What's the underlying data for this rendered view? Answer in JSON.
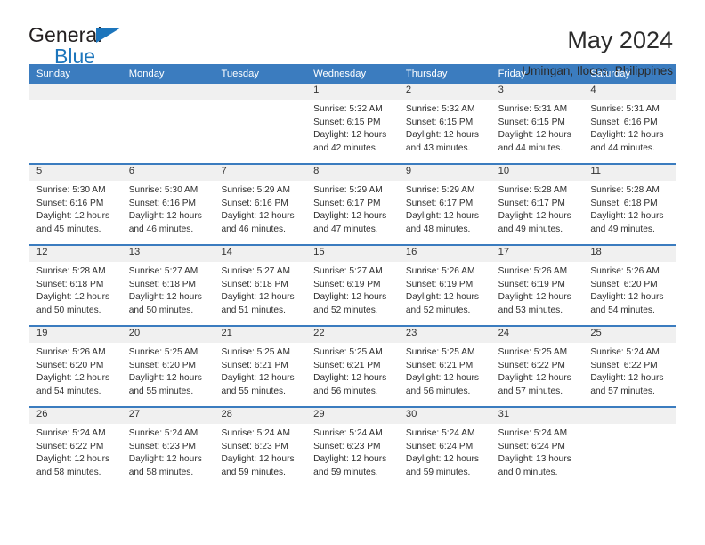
{
  "brand": {
    "name_part1": "General",
    "name_part2": "Blue",
    "triangle_icon": "triangle-icon",
    "accent_color": "#1c75bc"
  },
  "header": {
    "title": "May 2024",
    "subtitle": "Umingan, Ilocos, Philippines"
  },
  "calendar": {
    "header_bg": "#3b7cbf",
    "day_band_bg": "#f0f0f0",
    "weekdays": [
      "Sunday",
      "Monday",
      "Tuesday",
      "Wednesday",
      "Thursday",
      "Friday",
      "Saturday"
    ],
    "weeks": [
      [
        {
          "day": "",
          "lines": []
        },
        {
          "day": "",
          "lines": []
        },
        {
          "day": "",
          "lines": []
        },
        {
          "day": "1",
          "lines": [
            "Sunrise: 5:32 AM",
            "Sunset: 6:15 PM",
            "Daylight: 12 hours",
            "and 42 minutes."
          ]
        },
        {
          "day": "2",
          "lines": [
            "Sunrise: 5:32 AM",
            "Sunset: 6:15 PM",
            "Daylight: 12 hours",
            "and 43 minutes."
          ]
        },
        {
          "day": "3",
          "lines": [
            "Sunrise: 5:31 AM",
            "Sunset: 6:15 PM",
            "Daylight: 12 hours",
            "and 44 minutes."
          ]
        },
        {
          "day": "4",
          "lines": [
            "Sunrise: 5:31 AM",
            "Sunset: 6:16 PM",
            "Daylight: 12 hours",
            "and 44 minutes."
          ]
        }
      ],
      [
        {
          "day": "5",
          "lines": [
            "Sunrise: 5:30 AM",
            "Sunset: 6:16 PM",
            "Daylight: 12 hours",
            "and 45 minutes."
          ]
        },
        {
          "day": "6",
          "lines": [
            "Sunrise: 5:30 AM",
            "Sunset: 6:16 PM",
            "Daylight: 12 hours",
            "and 46 minutes."
          ]
        },
        {
          "day": "7",
          "lines": [
            "Sunrise: 5:29 AM",
            "Sunset: 6:16 PM",
            "Daylight: 12 hours",
            "and 46 minutes."
          ]
        },
        {
          "day": "8",
          "lines": [
            "Sunrise: 5:29 AM",
            "Sunset: 6:17 PM",
            "Daylight: 12 hours",
            "and 47 minutes."
          ]
        },
        {
          "day": "9",
          "lines": [
            "Sunrise: 5:29 AM",
            "Sunset: 6:17 PM",
            "Daylight: 12 hours",
            "and 48 minutes."
          ]
        },
        {
          "day": "10",
          "lines": [
            "Sunrise: 5:28 AM",
            "Sunset: 6:17 PM",
            "Daylight: 12 hours",
            "and 49 minutes."
          ]
        },
        {
          "day": "11",
          "lines": [
            "Sunrise: 5:28 AM",
            "Sunset: 6:18 PM",
            "Daylight: 12 hours",
            "and 49 minutes."
          ]
        }
      ],
      [
        {
          "day": "12",
          "lines": [
            "Sunrise: 5:28 AM",
            "Sunset: 6:18 PM",
            "Daylight: 12 hours",
            "and 50 minutes."
          ]
        },
        {
          "day": "13",
          "lines": [
            "Sunrise: 5:27 AM",
            "Sunset: 6:18 PM",
            "Daylight: 12 hours",
            "and 50 minutes."
          ]
        },
        {
          "day": "14",
          "lines": [
            "Sunrise: 5:27 AM",
            "Sunset: 6:18 PM",
            "Daylight: 12 hours",
            "and 51 minutes."
          ]
        },
        {
          "day": "15",
          "lines": [
            "Sunrise: 5:27 AM",
            "Sunset: 6:19 PM",
            "Daylight: 12 hours",
            "and 52 minutes."
          ]
        },
        {
          "day": "16",
          "lines": [
            "Sunrise: 5:26 AM",
            "Sunset: 6:19 PM",
            "Daylight: 12 hours",
            "and 52 minutes."
          ]
        },
        {
          "day": "17",
          "lines": [
            "Sunrise: 5:26 AM",
            "Sunset: 6:19 PM",
            "Daylight: 12 hours",
            "and 53 minutes."
          ]
        },
        {
          "day": "18",
          "lines": [
            "Sunrise: 5:26 AM",
            "Sunset: 6:20 PM",
            "Daylight: 12 hours",
            "and 54 minutes."
          ]
        }
      ],
      [
        {
          "day": "19",
          "lines": [
            "Sunrise: 5:26 AM",
            "Sunset: 6:20 PM",
            "Daylight: 12 hours",
            "and 54 minutes."
          ]
        },
        {
          "day": "20",
          "lines": [
            "Sunrise: 5:25 AM",
            "Sunset: 6:20 PM",
            "Daylight: 12 hours",
            "and 55 minutes."
          ]
        },
        {
          "day": "21",
          "lines": [
            "Sunrise: 5:25 AM",
            "Sunset: 6:21 PM",
            "Daylight: 12 hours",
            "and 55 minutes."
          ]
        },
        {
          "day": "22",
          "lines": [
            "Sunrise: 5:25 AM",
            "Sunset: 6:21 PM",
            "Daylight: 12 hours",
            "and 56 minutes."
          ]
        },
        {
          "day": "23",
          "lines": [
            "Sunrise: 5:25 AM",
            "Sunset: 6:21 PM",
            "Daylight: 12 hours",
            "and 56 minutes."
          ]
        },
        {
          "day": "24",
          "lines": [
            "Sunrise: 5:25 AM",
            "Sunset: 6:22 PM",
            "Daylight: 12 hours",
            "and 57 minutes."
          ]
        },
        {
          "day": "25",
          "lines": [
            "Sunrise: 5:24 AM",
            "Sunset: 6:22 PM",
            "Daylight: 12 hours",
            "and 57 minutes."
          ]
        }
      ],
      [
        {
          "day": "26",
          "lines": [
            "Sunrise: 5:24 AM",
            "Sunset: 6:22 PM",
            "Daylight: 12 hours",
            "and 58 minutes."
          ]
        },
        {
          "day": "27",
          "lines": [
            "Sunrise: 5:24 AM",
            "Sunset: 6:23 PM",
            "Daylight: 12 hours",
            "and 58 minutes."
          ]
        },
        {
          "day": "28",
          "lines": [
            "Sunrise: 5:24 AM",
            "Sunset: 6:23 PM",
            "Daylight: 12 hours",
            "and 59 minutes."
          ]
        },
        {
          "day": "29",
          "lines": [
            "Sunrise: 5:24 AM",
            "Sunset: 6:23 PM",
            "Daylight: 12 hours",
            "and 59 minutes."
          ]
        },
        {
          "day": "30",
          "lines": [
            "Sunrise: 5:24 AM",
            "Sunset: 6:24 PM",
            "Daylight: 12 hours",
            "and 59 minutes."
          ]
        },
        {
          "day": "31",
          "lines": [
            "Sunrise: 5:24 AM",
            "Sunset: 6:24 PM",
            "Daylight: 13 hours",
            "and 0 minutes."
          ]
        },
        {
          "day": "",
          "lines": []
        }
      ]
    ]
  }
}
